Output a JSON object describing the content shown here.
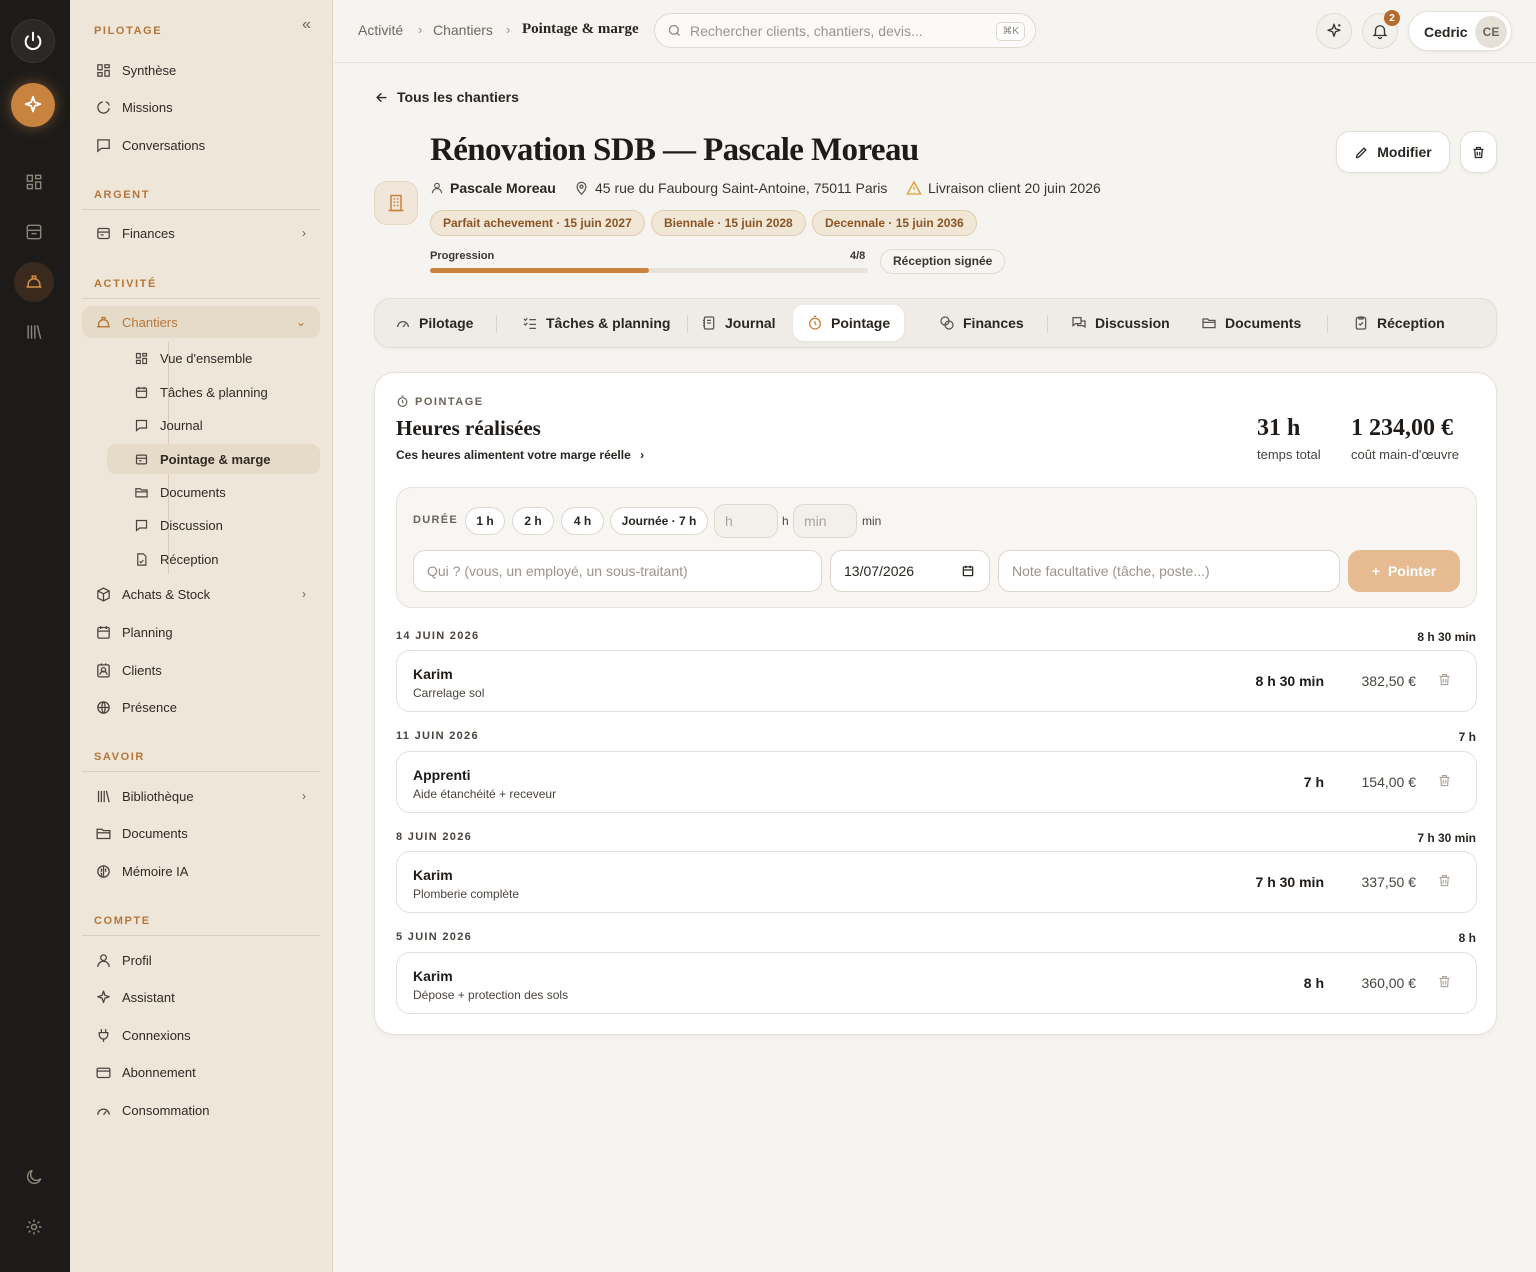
{
  "rail": {
    "icons": [
      "power-icon",
      "sparkle-icon",
      "grid-icon",
      "inbox-icon",
      "hardhat-icon",
      "library-icon",
      "moon-icon",
      "gear-icon"
    ]
  },
  "sidebar": {
    "sections": {
      "pilotage": "PILOTAGE",
      "argent": "ARGENT",
      "activite": "ACTIVITÉ",
      "savoir": "SAVOIR",
      "compte": "COMPTE"
    },
    "items": {
      "synthese": "Synthèse",
      "missions": "Missions",
      "conversations": "Conversations",
      "finances": "Finances",
      "chantiers": "Chantiers",
      "achats": "Achats & Stock",
      "planning": "Planning",
      "clients": "Clients",
      "presence": "Présence",
      "bibliotheque": "Bibliothèque",
      "documents": "Documents",
      "memoire": "Mémoire IA",
      "profil": "Profil",
      "assistant": "Assistant",
      "connexions": "Connexions",
      "abonnement": "Abonnement",
      "consommation": "Consommation"
    },
    "sub": {
      "vue": "Vue d'ensemble",
      "taches": "Tâches & planning",
      "journal": "Journal",
      "pointage": "Pointage & marge",
      "documents": "Documents",
      "discussion": "Discussion",
      "reception": "Réception"
    }
  },
  "topbar": {
    "crumbs": [
      "Activité",
      "Chantiers",
      "Pointage & marge"
    ],
    "search_placeholder": "Rechercher clients, chantiers, devis...",
    "kbd": "⌘K",
    "notif_count": "2",
    "user_name": "Cedric",
    "user_initials": "CE"
  },
  "project": {
    "back": "Tous les chantiers",
    "title": "Rénovation SDB — Pascale Moreau",
    "client": "Pascale Moreau",
    "address": "45 rue du Faubourg Saint-Antoine, 75011 Paris",
    "delivery": "Livraison client 20 juin 2026",
    "tags": [
      "Parfait achevement · 15 juin 2027",
      "Biennale · 15 juin 2028",
      "Decennale · 15 juin 2036"
    ],
    "progress_label": "Progression",
    "progress_text": "4/8",
    "progress_value": 0.5,
    "reception": "Réception signée",
    "edit": "Modifier"
  },
  "tabs": [
    "Pilotage",
    "Tâches & planning",
    "Journal",
    "Pointage",
    "Finances",
    "Discussion",
    "Documents",
    "Réception"
  ],
  "pointage": {
    "eyebrow": "POINTAGE",
    "title": "Heures réalisées",
    "subtitle": "Ces heures alimentent votre marge réelle",
    "total_hours": "31 h",
    "total_hours_label": "temps total",
    "labor_cost": "1 234,00 €",
    "labor_cost_label": "coût main-d'œuvre",
    "form": {
      "duration_label": "DURÉE",
      "chips": [
        "1 h",
        "2 h",
        "4 h",
        "Journée · 7 h"
      ],
      "h_placeholder": "h",
      "h_unit": "h",
      "min_placeholder": "min",
      "min_unit": "min",
      "who_placeholder": "Qui ? (vous, un employé, un sous-traitant)",
      "date": "13/07/2026",
      "note_placeholder": "Note facultative (tâche, poste...)",
      "submit": "Pointer"
    },
    "days": [
      {
        "date": "14 JUIN 2026",
        "total": "8 h 30 min",
        "entries": [
          {
            "who": "Karim",
            "task": "Carrelage sol",
            "duration": "8 h 30 min",
            "cost": "382,50 €"
          }
        ]
      },
      {
        "date": "11 JUIN 2026",
        "total": "7 h",
        "entries": [
          {
            "who": "Apprenti",
            "task": "Aide étanchéité + receveur",
            "duration": "7 h",
            "cost": "154,00 €"
          }
        ]
      },
      {
        "date": "8 JUIN 2026",
        "total": "7 h 30 min",
        "entries": [
          {
            "who": "Karim",
            "task": "Plomberie complète",
            "duration": "7 h 30 min",
            "cost": "337,50 €"
          }
        ]
      },
      {
        "date": "5 JUIN 2026",
        "total": "8 h",
        "entries": [
          {
            "who": "Karim",
            "task": "Dépose + protection des sols",
            "duration": "8 h",
            "cost": "360,00 €"
          }
        ]
      }
    ]
  },
  "colors": {
    "accent": "#c8843f",
    "rail": "#1d1b19",
    "sidebar": "#eee6d9"
  }
}
